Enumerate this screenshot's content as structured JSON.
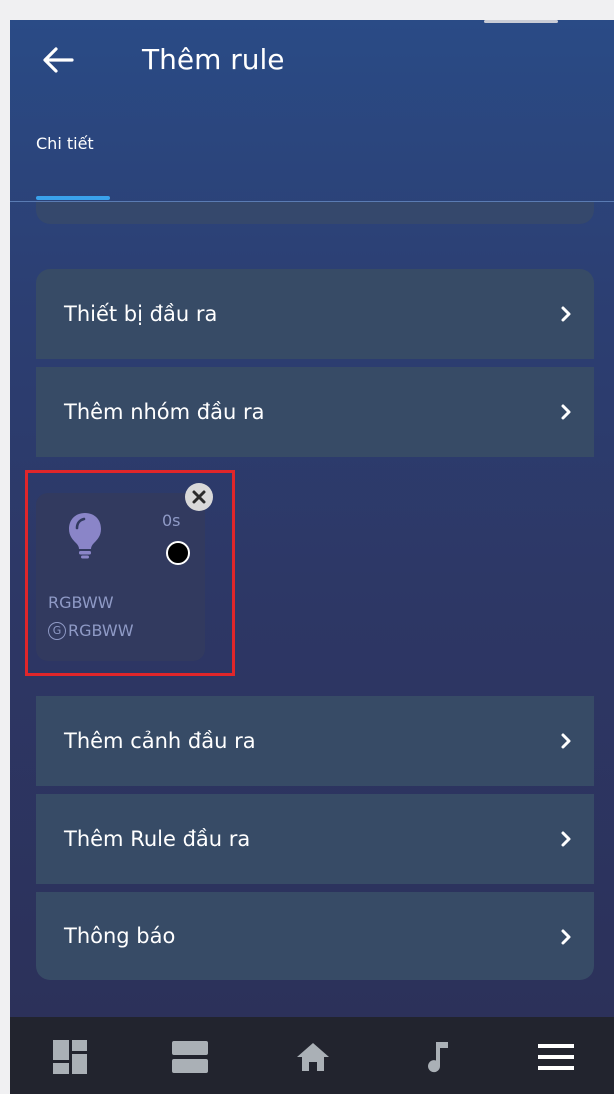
{
  "header": {
    "title": "Thêm rule"
  },
  "tabs": [
    {
      "label": "Chi tiết",
      "active": true
    }
  ],
  "output_rows": [
    {
      "label": "Thiết bị đầu ra"
    },
    {
      "label": "Thêm nhóm đầu ra"
    },
    {
      "label": "Thêm cảnh đầu ra"
    },
    {
      "label": "Thêm Rule đầu ra"
    },
    {
      "label": "Thông báo"
    }
  ],
  "device_card": {
    "delay": "0s",
    "name": "RGBWW",
    "group_icon": "G",
    "group_name": "RGBWW",
    "icon": "bulb-icon"
  },
  "bottom_nav": [
    {
      "icon": "dashboard-icon"
    },
    {
      "icon": "rooms-icon"
    },
    {
      "icon": "home-icon"
    },
    {
      "icon": "music-icon"
    },
    {
      "icon": "menu-icon"
    }
  ],
  "colors": {
    "accent": "#3aa2ec",
    "row_bg": "#374b66",
    "highlight": "#e0262a",
    "bottom_bar": "#22242e"
  }
}
